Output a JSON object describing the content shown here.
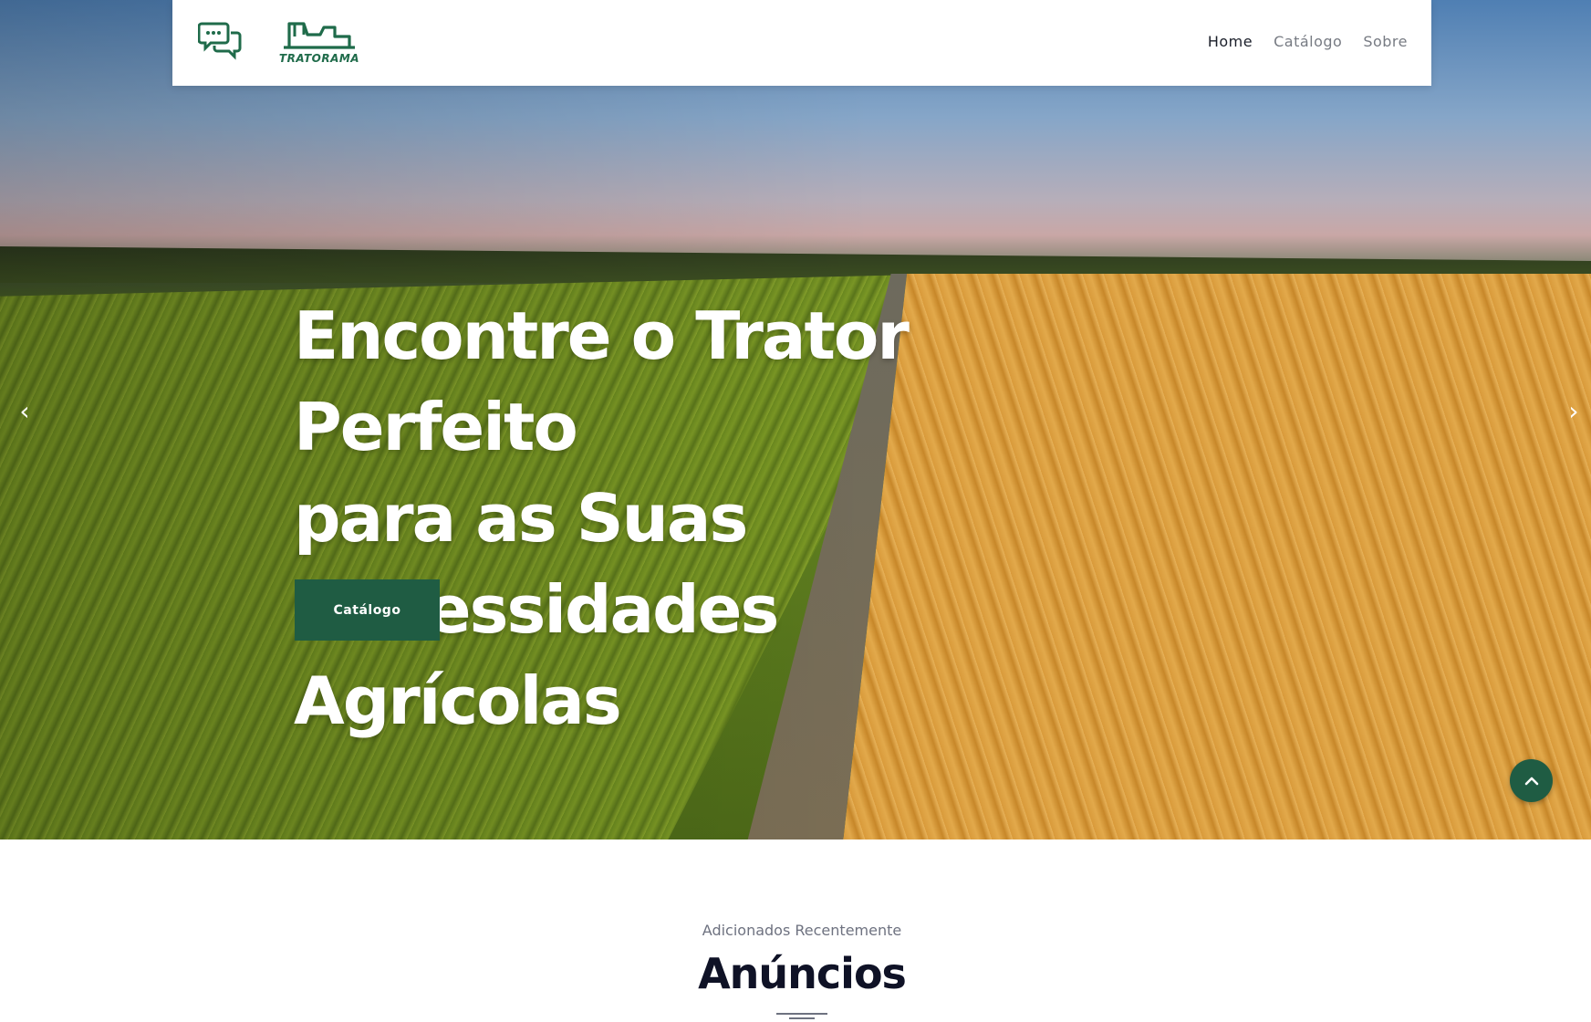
{
  "header": {
    "brand_name": "TRATORAMA",
    "nav": [
      {
        "label": "Home",
        "active": true
      },
      {
        "label": "Catálogo",
        "active": false
      },
      {
        "label": "Sobre",
        "active": false
      }
    ]
  },
  "hero": {
    "title_line1": "Encontre o Trator Perfeito",
    "title_line2": "para as Suas Necessidades",
    "title_line3": "Agrícolas",
    "cta_label": "Catálogo",
    "prev_arrow": "‹",
    "next_arrow": "›"
  },
  "section": {
    "subtitle": "Adicionados Recentemente",
    "title": "Anúncios"
  },
  "icons": {
    "chat": "chat-bubbles-icon",
    "tractor": "tractor-icon",
    "scroll_top": "chevron-up-icon"
  },
  "colors": {
    "brand_green": "#1f5c43",
    "heading_dark": "#0f1226",
    "nav_muted": "#777b83"
  }
}
